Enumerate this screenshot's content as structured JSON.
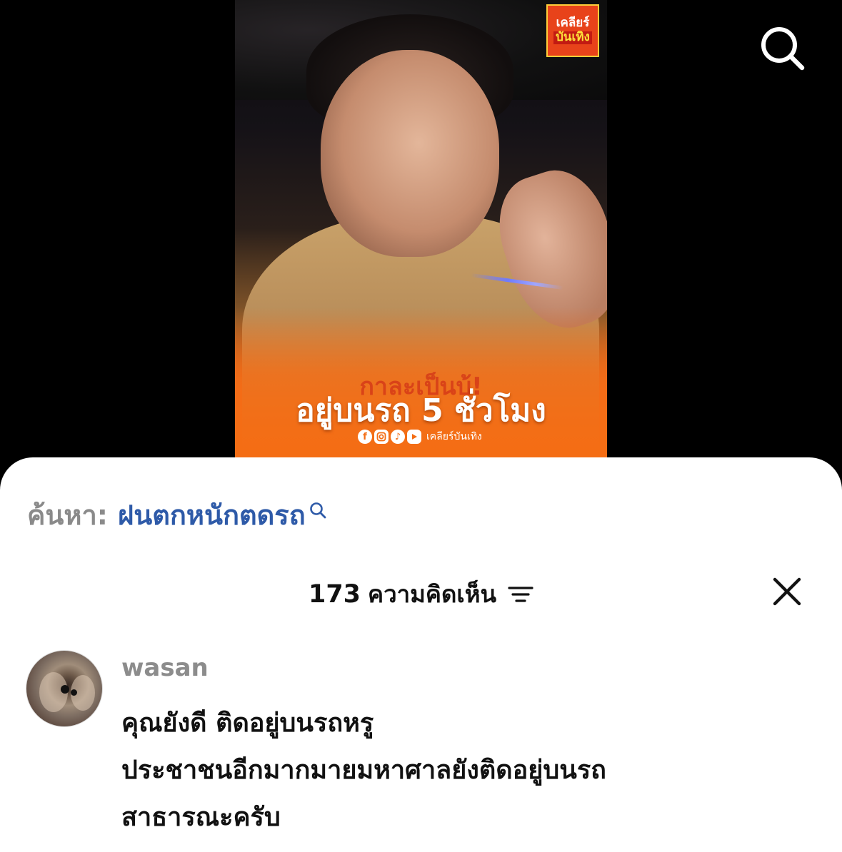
{
  "video": {
    "brand_logo": {
      "line1": "เคลียร์",
      "line2": "บันเทิง"
    },
    "caption_background": "กาละเป็นบ้!",
    "caption": "อยู่บนรถ 5 ชั่วโมง",
    "social_handle": "เคลียร์บันเทิง",
    "social_icons": [
      "facebook-icon",
      "instagram-icon",
      "tiktok-icon",
      "youtube-icon"
    ]
  },
  "search_suggestion": {
    "prefix": "ค้นหา:",
    "query": "ฝนตกหนักตดรถ"
  },
  "comments": {
    "count": "173",
    "label": "ความคิดเห็น"
  },
  "comment_list": [
    {
      "username": "wasan",
      "lines": [
        "คุณยังดี ติดอยู่บนรถหรู",
        "ประชาชนอีกมากมายมหาศาลยังติดอยู่บนรถ",
        "สาธารณะครับ"
      ]
    }
  ],
  "colors": {
    "accent_orange": "#f46d14",
    "search_query": "#2e5aa8",
    "muted_text": "#8a8a8a"
  }
}
